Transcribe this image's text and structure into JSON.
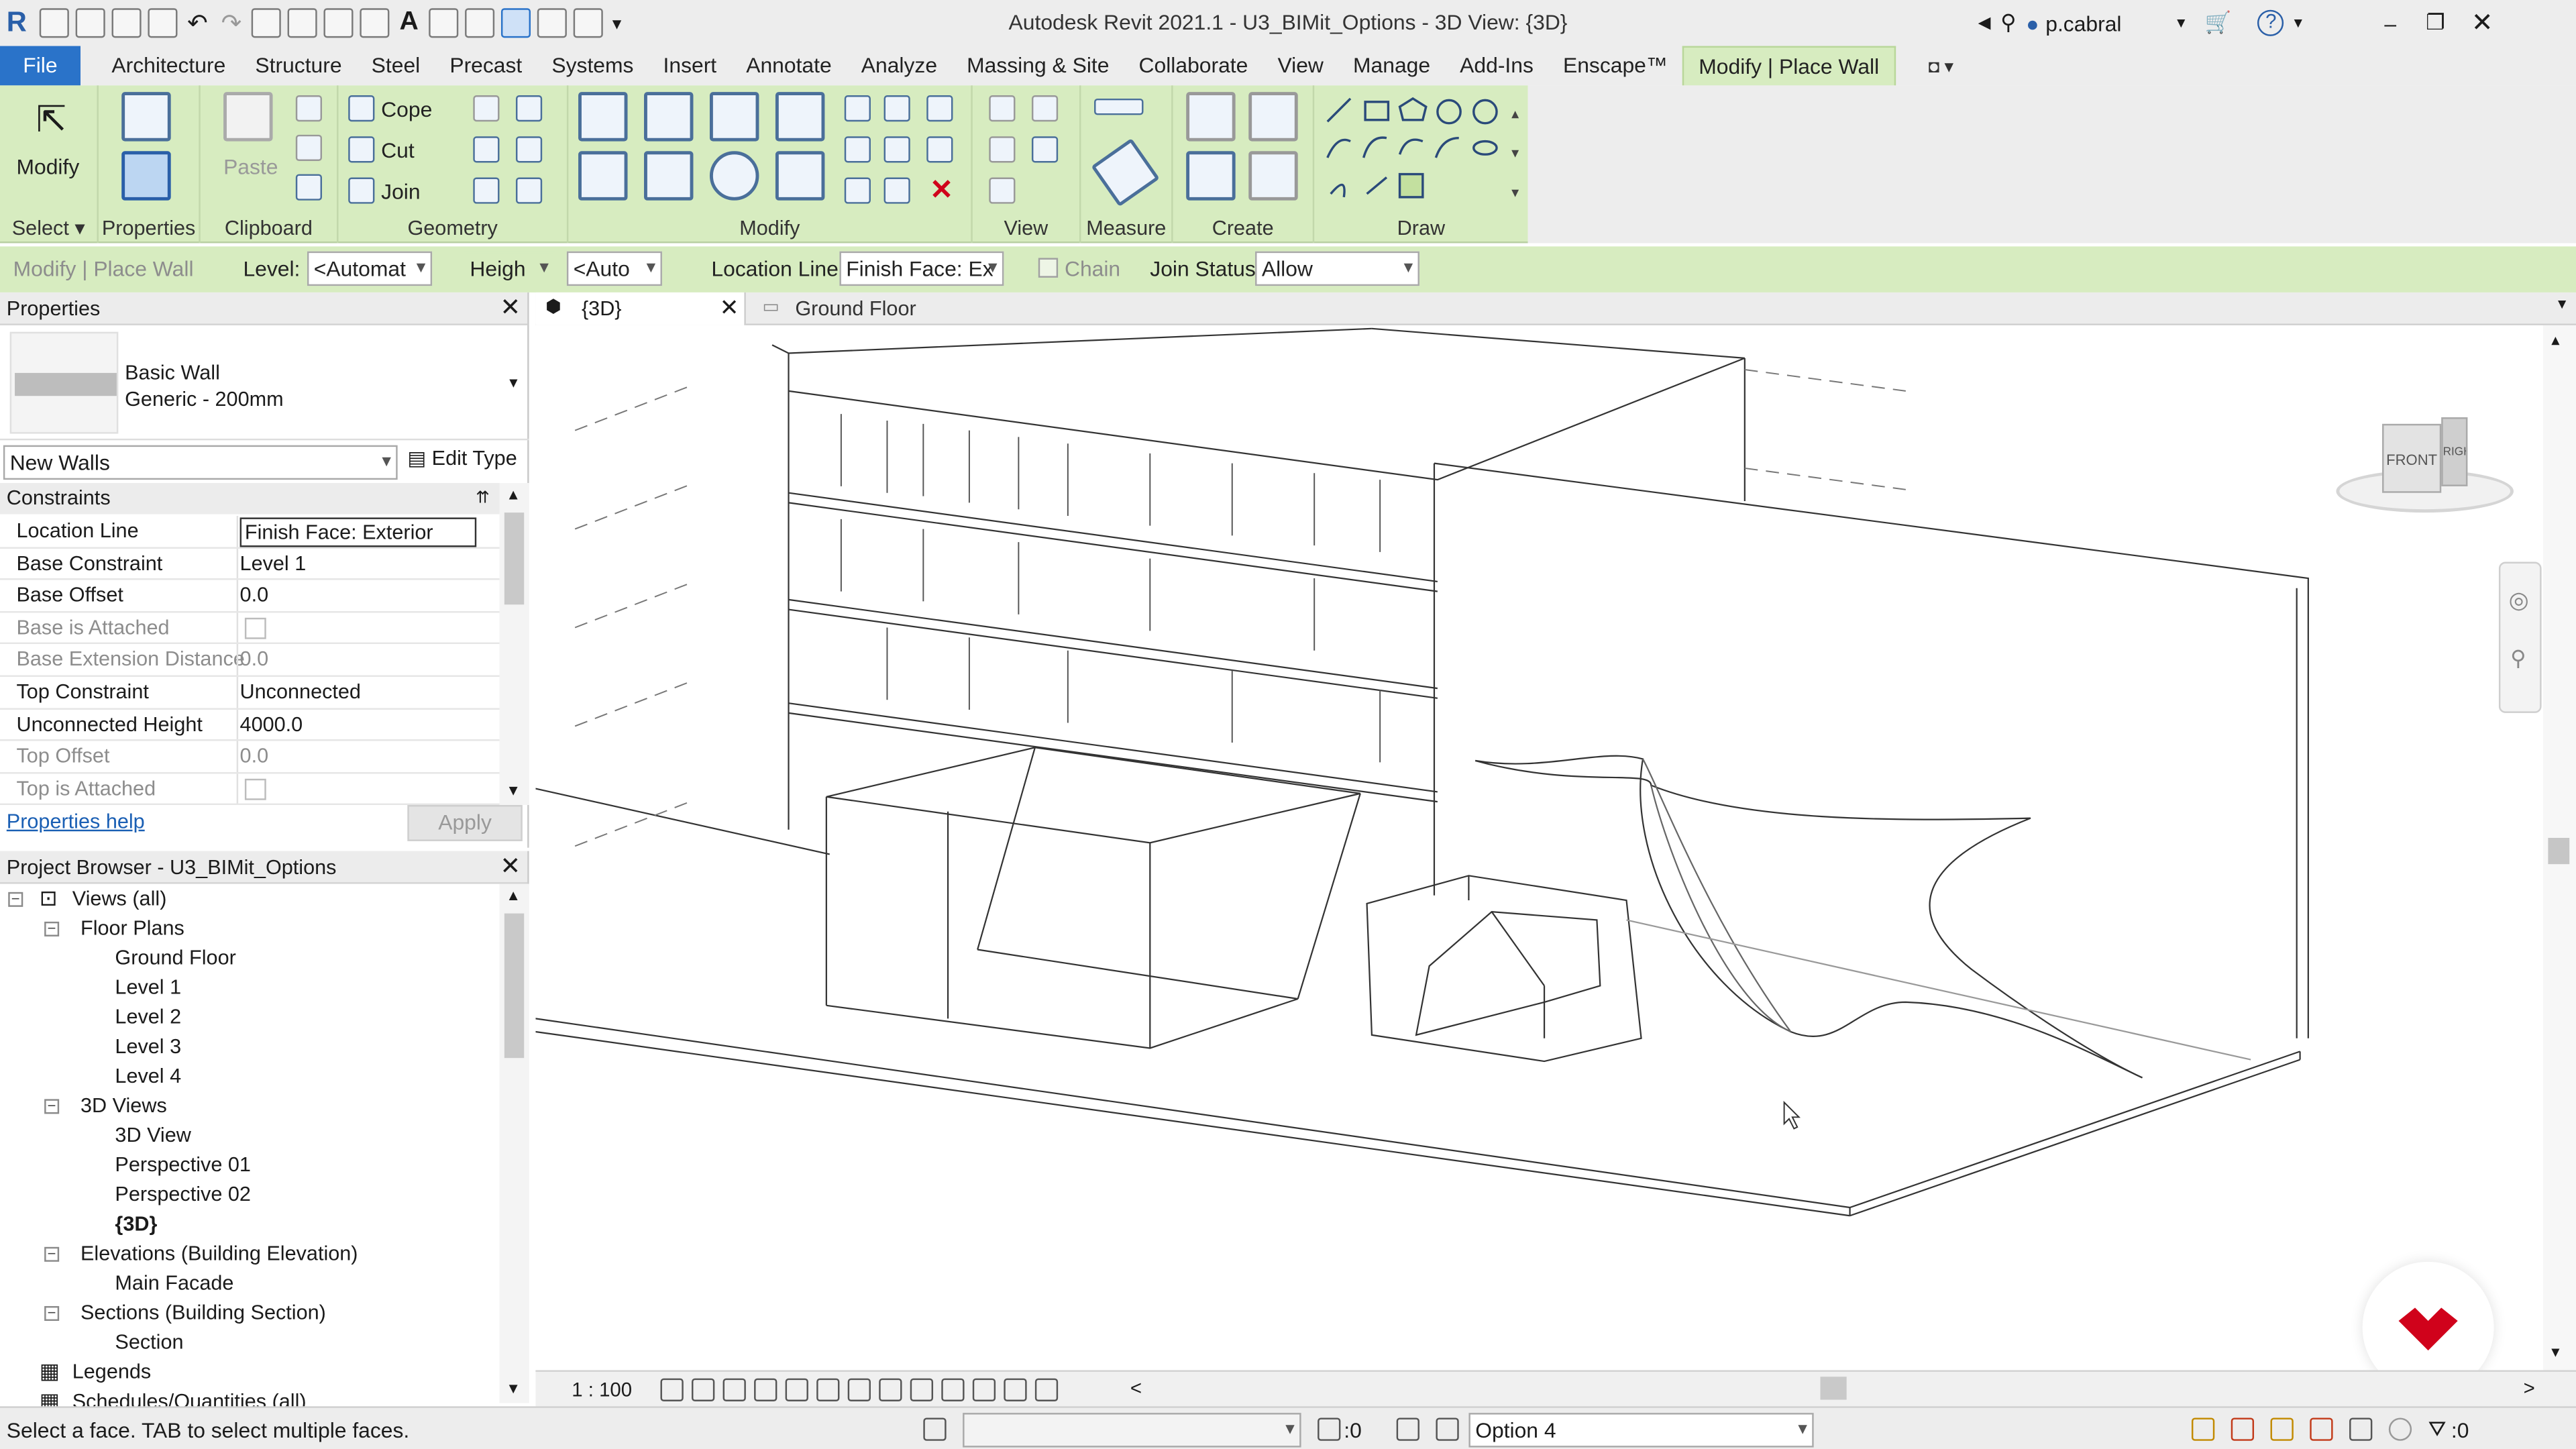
{
  "titlebar": {
    "title": "Autodesk Revit 2021.1 - U3_BIMit_Options - 3D View: {3D}",
    "user": "p.cabral",
    "app_icon": "R"
  },
  "tabs": [
    "File",
    "Architecture",
    "Structure",
    "Steel",
    "Precast",
    "Systems",
    "Insert",
    "Annotate",
    "Analyze",
    "Massing & Site",
    "Collaborate",
    "View",
    "Manage",
    "Add-Ins",
    "Enscape™",
    "Modify | Place Wall"
  ],
  "ribbon": {
    "select": {
      "modify_label": "Modify",
      "panel_label": "Select"
    },
    "properties": {
      "panel_label": "Properties"
    },
    "clipboard": {
      "paste_label": "Paste",
      "panel_label": "Clipboard"
    },
    "geometry": {
      "cope_label": "Cope",
      "cut_label": "Cut",
      "join_label": "Join",
      "panel_label": "Geometry"
    },
    "modify": {
      "panel_label": "Modify"
    },
    "view": {
      "panel_label": "View"
    },
    "measure": {
      "panel_label": "Measure"
    },
    "create": {
      "panel_label": "Create"
    },
    "draw": {
      "panel_label": "Draw"
    }
  },
  "optionsbar": {
    "context": "Modify | Place Wall",
    "level_label": "Level:",
    "level_value": "<Automat",
    "height_value": "Heigh",
    "auto_value": "<Auto",
    "location_line_label": "Location Line:",
    "location_line_value": "Finish Face: Ex",
    "chain_label": "Chain",
    "join_status_label": "Join Status:",
    "join_status_value": "Allow"
  },
  "properties": {
    "title": "Properties",
    "family": "Basic Wall",
    "type": "Generic - 200mm",
    "instance_filter": "New Walls",
    "edit_type": "Edit Type",
    "section": "Constraints",
    "rows": [
      {
        "k": "Location Line",
        "v": "Finish Face: Exterior",
        "editing": true
      },
      {
        "k": "Base Constraint",
        "v": "Level 1"
      },
      {
        "k": "Base Offset",
        "v": "0.0"
      },
      {
        "k": "Base is Attached",
        "v": "",
        "disabled": true,
        "check": true
      },
      {
        "k": "Base Extension Distance",
        "v": "0.0",
        "disabled": true
      },
      {
        "k": "Top Constraint",
        "v": "Unconnected"
      },
      {
        "k": "Unconnected Height",
        "v": "4000.0"
      },
      {
        "k": "Top Offset",
        "v": "0.0",
        "disabled": true
      },
      {
        "k": "Top is Attached",
        "v": "",
        "disabled": true,
        "check": true
      }
    ],
    "help": "Properties help",
    "apply": "Apply"
  },
  "browser": {
    "title": "Project Browser - U3_BIMit_Options",
    "root": "Views (all)",
    "floor_plans": "Floor Plans",
    "floor_items": [
      "Ground Floor",
      "Level 1",
      "Level 2",
      "Level 3",
      "Level 4"
    ],
    "views3d": "3D Views",
    "views3d_items": [
      "3D View",
      "Perspective 01",
      "Perspective 02",
      "{3D}"
    ],
    "elevations": "Elevations (Building Elevation)",
    "elevation_items": [
      "Main Facade"
    ],
    "sections": "Sections (Building Section)",
    "section_items": [
      "Section"
    ],
    "legends": "Legends",
    "schedules": "Schedules/Quantities (all)"
  },
  "viewtabs": {
    "active": "{3D}",
    "other": "Ground Floor"
  },
  "viewcube": {
    "front": "FRONT",
    "right": "RIGHT"
  },
  "viewctl": {
    "scale": "1 : 100"
  },
  "statusbar": {
    "message": "Select a face. TAB to select multiple faces.",
    "selection_count": ":0",
    "design_option": "Option 4",
    "filter_count": ":0"
  },
  "colors": {
    "ribbon": "#d7ecc0",
    "file_tab": "#2a73c9",
    "logo": "#d0021b"
  }
}
